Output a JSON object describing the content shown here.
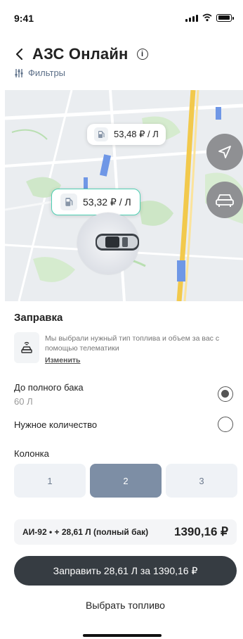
{
  "status_bar": {
    "time": "9:41"
  },
  "header": {
    "title": "АЗС Онлайн",
    "info_glyph": "i",
    "filters_label": "Фильтры"
  },
  "map": {
    "pins": [
      {
        "price": "53,48 ₽ / Л",
        "active": false
      },
      {
        "price": "53,32 ₽ / Л",
        "active": true
      }
    ]
  },
  "refuel": {
    "title": "Заправка",
    "telematics_text": "Мы выбрали нужный тип топлива и объем за вас с помощью телематики",
    "telematics_link": "Изменить"
  },
  "options": [
    {
      "label": "До полного бака",
      "sub": "60 Л",
      "selected": true
    },
    {
      "label": "Нужное количество",
      "sub": "",
      "selected": false
    }
  ],
  "pumps": {
    "title": "Колонка",
    "items": [
      "1",
      "2",
      "3"
    ],
    "selected": "2"
  },
  "summary": {
    "description": "АИ-92  •  + 28,61 Л (полный бак)",
    "price": "1390,16 ₽"
  },
  "actions": {
    "primary": "Заправить 28,61 Л за 1390,16 ₽",
    "secondary": "Выбрать топливо"
  },
  "colors": {
    "accent_pin_border": "#4fd1b4",
    "primary_button": "#363c42",
    "selected_pump": "#7d8ea5"
  }
}
